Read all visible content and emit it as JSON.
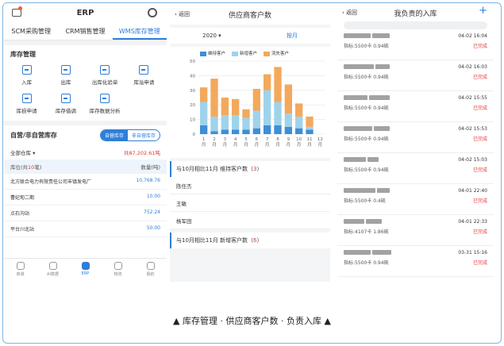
{
  "screen1": {
    "title": "ERP",
    "tabs": [
      "SCM采购管理",
      "CRM销售管理",
      "WMS库存管理"
    ],
    "section_title": "库存管理",
    "grid_items": [
      "入库",
      "出库",
      "出库化验单",
      "库溢申请",
      "库损申请",
      "库存借调",
      "库存数据分析"
    ],
    "stock_title": "自营/非自营库存",
    "seg_on": "自营库存",
    "seg_off": "非自营库存",
    "warehouse_label": "全部仓库 ▾",
    "total_amount": "共87,202.61吨",
    "table_col1_prefix": "库位(共",
    "table_col1_count": "10",
    "table_col1_suffix": "笔)",
    "table_col2": "数量(吨)",
    "rows": [
      {
        "name": "北方联合电力有限责任公司丰镇发电厂",
        "value": "10,768.76"
      },
      {
        "name": "曹妃甸二期",
        "value": "10.00"
      },
      {
        "name": "点石沟站",
        "value": "752.24"
      },
      {
        "name": "平台川北站",
        "value": "50.00"
      }
    ],
    "bottom_nav": [
      "商城",
      "AI数据",
      "ERP",
      "物流",
      "我的"
    ]
  },
  "screen2": {
    "back": "返回",
    "title": "供应商客户数",
    "year": "2020 ▾",
    "month_btn": "按月",
    "cmp1_prefix": "与10月相比11月 维持客户数（",
    "cmp1_n": "3",
    "cmp1_suffix": "）",
    "names": [
      "陈任杰",
      "王敏",
      "杨军田"
    ],
    "cmp2_prefix": "与10月相比11月 新增客户数（",
    "cmp2_n": "6",
    "cmp2_suffix": "）"
  },
  "chart_data": {
    "type": "bar",
    "categories": [
      "1月",
      "2月",
      "3月",
      "4月",
      "5月",
      "6月",
      "7月",
      "8月",
      "9月",
      "10月",
      "11月",
      "12月"
    ],
    "series": [
      {
        "name": "维持客户",
        "color": "#3e8ed8",
        "values": [
          6,
          2,
          3,
          3,
          3,
          4,
          6,
          6,
          5,
          4,
          3,
          0
        ]
      },
      {
        "name": "新增客户",
        "color": "#9fd3ec",
        "values": [
          16,
          10,
          10,
          10,
          8,
          12,
          24,
          16,
          9,
          8,
          2,
          0
        ]
      },
      {
        "name": "流失客户",
        "color": "#f3a95b",
        "values": [
          10,
          26,
          12,
          11,
          6,
          15,
          11,
          24,
          20,
          9,
          7,
          0
        ]
      }
    ],
    "ylim": [
      0,
      50
    ],
    "yticks": [
      0,
      10,
      20,
      30,
      40,
      50
    ],
    "grid": true,
    "legend": "top"
  },
  "screen3": {
    "back": "返回",
    "title": "我负责的入库",
    "plus": "+",
    "items": [
      {
        "date": "04-02 16:04",
        "spec": "指标:5500卡 0.94硫",
        "status": "已完成"
      },
      {
        "date": "04-02 16:03",
        "spec": "指标:5500卡 0.94硫",
        "status": "已完成"
      },
      {
        "date": "04-02 15:55",
        "spec": "指标:5500卡 0.94硫",
        "status": "已完成"
      },
      {
        "date": "04-02 15:53",
        "spec": "指标:5500卡 0.94硫",
        "status": "已完成"
      },
      {
        "date": "04-02 15:03",
        "spec": "指标:5500卡 0.94硫",
        "status": "已完成"
      },
      {
        "date": "04-01 22:40",
        "spec": "指标:5500卡 0.4硫",
        "status": "已完成"
      },
      {
        "date": "04-01 22:33",
        "spec": "指标:4107卡 1.86硫",
        "status": "已完成"
      },
      {
        "date": "03-31 15:16",
        "spec": "指标:5500卡 0.94硫",
        "status": "已完成"
      }
    ]
  },
  "caption": "▲ 库存管理 · 供应商客户数 · 负责入库 ▲",
  "colors": {
    "accent": "#2f7ed8",
    "alert": "#e23a3a",
    "frame": "#7fb3e6"
  }
}
